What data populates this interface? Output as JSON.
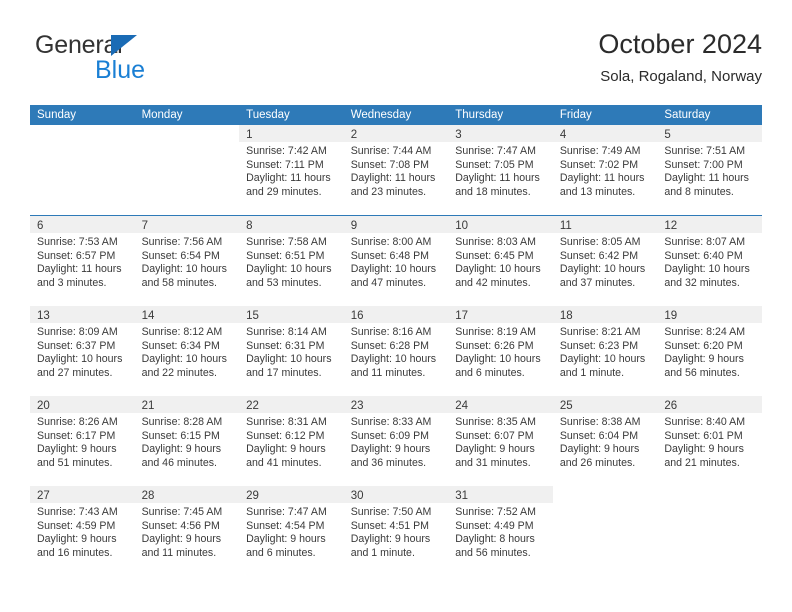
{
  "brand": {
    "line1": "General",
    "line2": "Blue",
    "triangle_color": "#1a6bb5",
    "blue_color": "#1a7fd4"
  },
  "header": {
    "title": "October 2024",
    "subtitle": "Sola, Rogaland, Norway"
  },
  "theme": {
    "header_bg": "#2e7ab8",
    "header_text": "#ffffff",
    "day_band_bg": "#f0f0f0",
    "text": "#3a3a3a",
    "week_rule": "#2e7ab8"
  },
  "weekdays": [
    "Sunday",
    "Monday",
    "Tuesday",
    "Wednesday",
    "Thursday",
    "Friday",
    "Saturday"
  ],
  "weeks": [
    [
      {
        "blank": true
      },
      {
        "blank": true
      },
      {
        "day": "1",
        "sunrise": "Sunrise: 7:42 AM",
        "sunset": "Sunset: 7:11 PM",
        "daylight1": "Daylight: 11 hours",
        "daylight2": "and 29 minutes."
      },
      {
        "day": "2",
        "sunrise": "Sunrise: 7:44 AM",
        "sunset": "Sunset: 7:08 PM",
        "daylight1": "Daylight: 11 hours",
        "daylight2": "and 23 minutes."
      },
      {
        "day": "3",
        "sunrise": "Sunrise: 7:47 AM",
        "sunset": "Sunset: 7:05 PM",
        "daylight1": "Daylight: 11 hours",
        "daylight2": "and 18 minutes."
      },
      {
        "day": "4",
        "sunrise": "Sunrise: 7:49 AM",
        "sunset": "Sunset: 7:02 PM",
        "daylight1": "Daylight: 11 hours",
        "daylight2": "and 13 minutes."
      },
      {
        "day": "5",
        "sunrise": "Sunrise: 7:51 AM",
        "sunset": "Sunset: 7:00 PM",
        "daylight1": "Daylight: 11 hours",
        "daylight2": "and 8 minutes."
      }
    ],
    [
      {
        "day": "6",
        "sunrise": "Sunrise: 7:53 AM",
        "sunset": "Sunset: 6:57 PM",
        "daylight1": "Daylight: 11 hours",
        "daylight2": "and 3 minutes."
      },
      {
        "day": "7",
        "sunrise": "Sunrise: 7:56 AM",
        "sunset": "Sunset: 6:54 PM",
        "daylight1": "Daylight: 10 hours",
        "daylight2": "and 58 minutes."
      },
      {
        "day": "8",
        "sunrise": "Sunrise: 7:58 AM",
        "sunset": "Sunset: 6:51 PM",
        "daylight1": "Daylight: 10 hours",
        "daylight2": "and 53 minutes."
      },
      {
        "day": "9",
        "sunrise": "Sunrise: 8:00 AM",
        "sunset": "Sunset: 6:48 PM",
        "daylight1": "Daylight: 10 hours",
        "daylight2": "and 47 minutes."
      },
      {
        "day": "10",
        "sunrise": "Sunrise: 8:03 AM",
        "sunset": "Sunset: 6:45 PM",
        "daylight1": "Daylight: 10 hours",
        "daylight2": "and 42 minutes."
      },
      {
        "day": "11",
        "sunrise": "Sunrise: 8:05 AM",
        "sunset": "Sunset: 6:42 PM",
        "daylight1": "Daylight: 10 hours",
        "daylight2": "and 37 minutes."
      },
      {
        "day": "12",
        "sunrise": "Sunrise: 8:07 AM",
        "sunset": "Sunset: 6:40 PM",
        "daylight1": "Daylight: 10 hours",
        "daylight2": "and 32 minutes."
      }
    ],
    [
      {
        "day": "13",
        "sunrise": "Sunrise: 8:09 AM",
        "sunset": "Sunset: 6:37 PM",
        "daylight1": "Daylight: 10 hours",
        "daylight2": "and 27 minutes."
      },
      {
        "day": "14",
        "sunrise": "Sunrise: 8:12 AM",
        "sunset": "Sunset: 6:34 PM",
        "daylight1": "Daylight: 10 hours",
        "daylight2": "and 22 minutes."
      },
      {
        "day": "15",
        "sunrise": "Sunrise: 8:14 AM",
        "sunset": "Sunset: 6:31 PM",
        "daylight1": "Daylight: 10 hours",
        "daylight2": "and 17 minutes."
      },
      {
        "day": "16",
        "sunrise": "Sunrise: 8:16 AM",
        "sunset": "Sunset: 6:28 PM",
        "daylight1": "Daylight: 10 hours",
        "daylight2": "and 11 minutes."
      },
      {
        "day": "17",
        "sunrise": "Sunrise: 8:19 AM",
        "sunset": "Sunset: 6:26 PM",
        "daylight1": "Daylight: 10 hours",
        "daylight2": "and 6 minutes."
      },
      {
        "day": "18",
        "sunrise": "Sunrise: 8:21 AM",
        "sunset": "Sunset: 6:23 PM",
        "daylight1": "Daylight: 10 hours",
        "daylight2": "and 1 minute."
      },
      {
        "day": "19",
        "sunrise": "Sunrise: 8:24 AM",
        "sunset": "Sunset: 6:20 PM",
        "daylight1": "Daylight: 9 hours",
        "daylight2": "and 56 minutes."
      }
    ],
    [
      {
        "day": "20",
        "sunrise": "Sunrise: 8:26 AM",
        "sunset": "Sunset: 6:17 PM",
        "daylight1": "Daylight: 9 hours",
        "daylight2": "and 51 minutes."
      },
      {
        "day": "21",
        "sunrise": "Sunrise: 8:28 AM",
        "sunset": "Sunset: 6:15 PM",
        "daylight1": "Daylight: 9 hours",
        "daylight2": "and 46 minutes."
      },
      {
        "day": "22",
        "sunrise": "Sunrise: 8:31 AM",
        "sunset": "Sunset: 6:12 PM",
        "daylight1": "Daylight: 9 hours",
        "daylight2": "and 41 minutes."
      },
      {
        "day": "23",
        "sunrise": "Sunrise: 8:33 AM",
        "sunset": "Sunset: 6:09 PM",
        "daylight1": "Daylight: 9 hours",
        "daylight2": "and 36 minutes."
      },
      {
        "day": "24",
        "sunrise": "Sunrise: 8:35 AM",
        "sunset": "Sunset: 6:07 PM",
        "daylight1": "Daylight: 9 hours",
        "daylight2": "and 31 minutes."
      },
      {
        "day": "25",
        "sunrise": "Sunrise: 8:38 AM",
        "sunset": "Sunset: 6:04 PM",
        "daylight1": "Daylight: 9 hours",
        "daylight2": "and 26 minutes."
      },
      {
        "day": "26",
        "sunrise": "Sunrise: 8:40 AM",
        "sunset": "Sunset: 6:01 PM",
        "daylight1": "Daylight: 9 hours",
        "daylight2": "and 21 minutes."
      }
    ],
    [
      {
        "day": "27",
        "sunrise": "Sunrise: 7:43 AM",
        "sunset": "Sunset: 4:59 PM",
        "daylight1": "Daylight: 9 hours",
        "daylight2": "and 16 minutes."
      },
      {
        "day": "28",
        "sunrise": "Sunrise: 7:45 AM",
        "sunset": "Sunset: 4:56 PM",
        "daylight1": "Daylight: 9 hours",
        "daylight2": "and 11 minutes."
      },
      {
        "day": "29",
        "sunrise": "Sunrise: 7:47 AM",
        "sunset": "Sunset: 4:54 PM",
        "daylight1": "Daylight: 9 hours",
        "daylight2": "and 6 minutes."
      },
      {
        "day": "30",
        "sunrise": "Sunrise: 7:50 AM",
        "sunset": "Sunset: 4:51 PM",
        "daylight1": "Daylight: 9 hours",
        "daylight2": "and 1 minute."
      },
      {
        "day": "31",
        "sunrise": "Sunrise: 7:52 AM",
        "sunset": "Sunset: 4:49 PM",
        "daylight1": "Daylight: 8 hours",
        "daylight2": "and 56 minutes."
      },
      {
        "blank": true
      },
      {
        "blank": true
      }
    ]
  ]
}
